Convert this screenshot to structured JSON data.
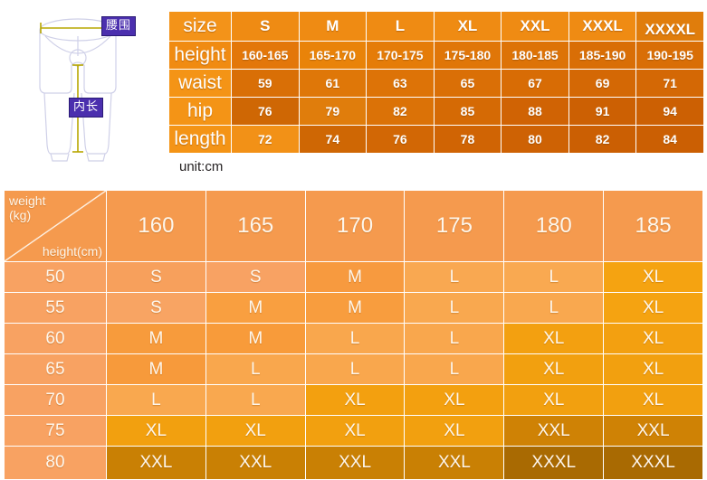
{
  "figure": {
    "alt_name": "pants-measurement-diagram",
    "labels": {
      "waist": "腰围",
      "inseam": "内长"
    }
  },
  "unit_note": "unit:cm",
  "size_table": {
    "rows": [
      {
        "label": "size",
        "kind": "header",
        "values": [
          "S",
          "M",
          "L",
          "XL",
          "XXL",
          "XXXL",
          "XXXXL"
        ],
        "bg": [
          "#ef8b13",
          "#ef8b13",
          "#ef8b13",
          "#ef8b13",
          "#ef8b13",
          "#ef8b13",
          "#e07d0c"
        ],
        "label_bg": "#f39319"
      },
      {
        "label": "height",
        "kind": "data",
        "values": [
          "160-165",
          "165-170",
          "170-175",
          "175-180",
          "180-185",
          "185-190",
          "190-195"
        ],
        "bg": [
          "#e3770a",
          "#e98309",
          "#e57c08",
          "#e07608",
          "#dd7307",
          "#d96e06",
          "#d96e06"
        ],
        "label_bg": "#f08b12"
      },
      {
        "label": "waist",
        "kind": "data",
        "values": [
          "59",
          "61",
          "63",
          "65",
          "67",
          "69",
          "71"
        ],
        "bg": [
          "#d96f06",
          "#df7708",
          "#dd7307",
          "#da6f06",
          "#d86c05",
          "#d46805",
          "#d46805"
        ],
        "label_bg": "#f49416"
      },
      {
        "label": "hip",
        "kind": "data",
        "values": [
          "76",
          "79",
          "82",
          "85",
          "88",
          "91",
          "94"
        ],
        "bg": [
          "#cf6704",
          "#e07d0c",
          "#db7207",
          "#d56a05",
          "#d06304",
          "#cc6003",
          "#cc6003"
        ],
        "label_bg": "#f49416"
      },
      {
        "label": "length",
        "kind": "data",
        "values": [
          "72",
          "74",
          "76",
          "78",
          "80",
          "82",
          "84"
        ],
        "bg": [
          "#f29117",
          "#cf6704",
          "#d26705",
          "#d06404",
          "#ce6204",
          "#cb5f03",
          "#cb5f03"
        ],
        "label_bg": "#f49416"
      }
    ]
  },
  "fit_table": {
    "corner": {
      "weight_label": "weight (kg)",
      "height_label": "height(cm)"
    },
    "column_headers": [
      "160",
      "165",
      "170",
      "175",
      "180",
      "185"
    ],
    "row_headers": [
      "50",
      "55",
      "60",
      "65",
      "70",
      "75",
      "80"
    ],
    "header_bg": "#f59a4e",
    "rowhead_bg": "#f8a262",
    "cells": [
      [
        "S",
        "S",
        "M",
        "L",
        "L",
        "XL"
      ],
      [
        "S",
        "M",
        "M",
        "L",
        "L",
        "XL"
      ],
      [
        "M",
        "M",
        "L",
        "L",
        "XL",
        "XL"
      ],
      [
        "M",
        "L",
        "L",
        "L",
        "XL",
        "XL"
      ],
      [
        "L",
        "L",
        "XL",
        "XL",
        "XL",
        "XL"
      ],
      [
        "XL",
        "XL",
        "XL",
        "XL",
        "XXL",
        "XXL"
      ],
      [
        "XXL",
        "XXL",
        "XXL",
        "XXL",
        "XXXL",
        "XXXL"
      ]
    ],
    "cell_bg": [
      [
        "#f7a05c",
        "#f8a263",
        "#f79a3f",
        "#f9a851",
        "#f9a951",
        "#f5a311"
      ],
      [
        "#f8a463",
        "#f99f40",
        "#f89d3e",
        "#f9a84f",
        "#f9a84f",
        "#f5a311"
      ],
      [
        "#f79b3c",
        "#f89b3a",
        "#f9a74d",
        "#f9a74d",
        "#f3a010",
        "#f3a010"
      ],
      [
        "#f79a3b",
        "#f9a74d",
        "#f9a74d",
        "#f9a74d",
        "#f2a00f",
        "#f2a00f"
      ],
      [
        "#f9a84f",
        "#f9a84f",
        "#f3a00f",
        "#f3a00f",
        "#f2a00f",
        "#f2a00f"
      ],
      [
        "#f2a00f",
        "#f2a00f",
        "#f2a00f",
        "#f2a00f",
        "#cf8205",
        "#cf8205"
      ],
      [
        "#c98004",
        "#c98004",
        "#c98004",
        "#c98004",
        "#a96a02",
        "#a96a02"
      ]
    ]
  },
  "colors": {
    "orange_primary": "#ef8b13",
    "orange_dark": "#cb5f03",
    "peach": "#f8a262",
    "label_purple": "#4b2fae",
    "white": "#ffffff"
  }
}
